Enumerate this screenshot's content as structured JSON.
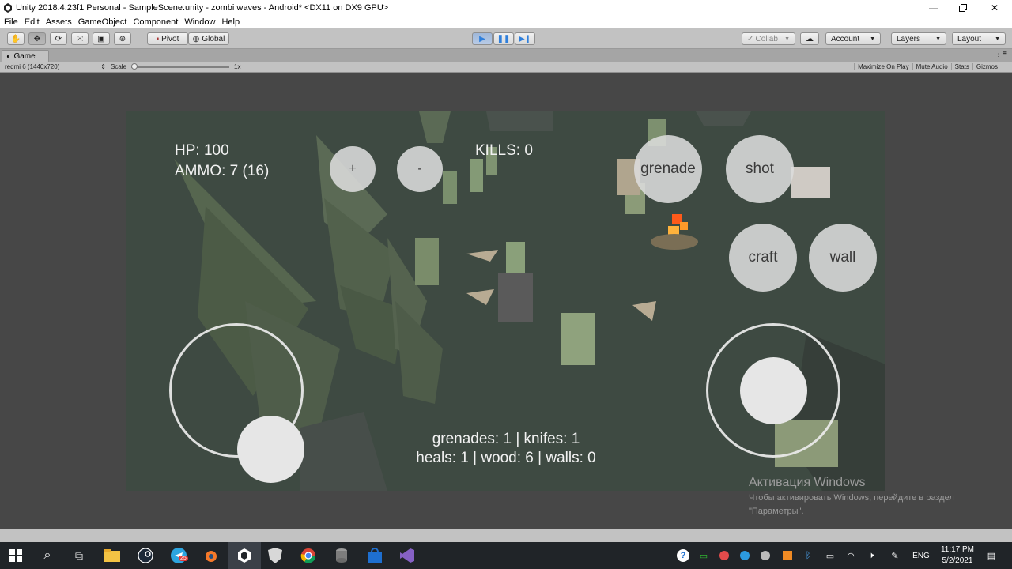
{
  "window": {
    "title": "Unity 2018.4.23f1 Personal - SampleScene.unity - zombi waves - Android* <DX11 on DX9 GPU>"
  },
  "menu": [
    "File",
    "Edit",
    "Assets",
    "GameObject",
    "Component",
    "Window",
    "Help"
  ],
  "toolbar": {
    "pivot_label": "Pivot",
    "global_label": "Global",
    "collab_label": "Collab",
    "account_label": "Account",
    "layers_label": "Layers",
    "layout_label": "Layout"
  },
  "game_panel": {
    "tab_label": "Game",
    "resolution": "redmi 6 (1440x720)",
    "scale_label": "Scale",
    "scale_value": "1x",
    "maximize_on_play": "Maximize On Play",
    "mute_audio": "Mute Audio",
    "stats": "Stats",
    "gizmos": "Gizmos"
  },
  "hud": {
    "hp": "HP: 100",
    "ammo": "AMMO: 7 (16)",
    "kills": "KILLS: 0",
    "plus": "+",
    "minus": "-",
    "grenade": "grenade",
    "shot": "shot",
    "craft": "craft",
    "wall": "wall",
    "inventory_line1": "grenades: 1 | knifes: 1",
    "inventory_line2": "heals: 1 | wood: 6 | walls: 0"
  },
  "activation": {
    "title": "Активация Windows",
    "line1": "Чтобы активировать Windows, перейдите в раздел",
    "line2": "\"Параметры\"."
  },
  "taskbar": {
    "language": "ENG",
    "time": "11:17 PM",
    "date": "5/2/2021",
    "telegram_badge": "25"
  },
  "colors": {
    "accent_play": "#2f7fdb",
    "game_bg": "#3f4b43",
    "viewport_bg": "#474747"
  }
}
